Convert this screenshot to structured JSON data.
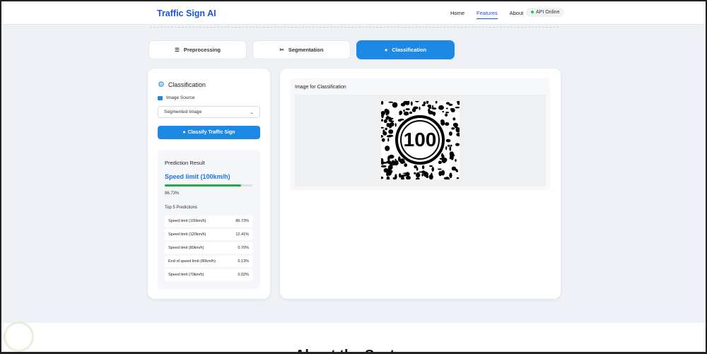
{
  "nav": {
    "brand": "Traffic Sign AI",
    "links": [
      "Home",
      "Features",
      "About"
    ],
    "active": "Features",
    "status": "API Online"
  },
  "tabs": [
    {
      "label": "Preprocessing",
      "icon": "sliders-icon"
    },
    {
      "label": "Segmentation",
      "icon": "scissors-icon"
    },
    {
      "label": "Classification",
      "icon": "brain-icon",
      "active": true
    }
  ],
  "panel": {
    "title": "Classification",
    "source_label": "Image Source",
    "source_value": "Segmented Image",
    "button": "Classify Traffic Sign"
  },
  "prediction": {
    "title": "Prediction Result",
    "name": "Speed limit (100km/h)",
    "confidence": "86.73%",
    "confidence_value": 0.8673,
    "top5_title": "Top 5 Predictions",
    "top5": [
      {
        "label": "Speed limit (100km/h)",
        "value": "86.73%"
      },
      {
        "label": "Speed limit (120km/h)",
        "value": "12.41%"
      },
      {
        "label": "Speed limit (80km/h)",
        "value": "0.70%"
      },
      {
        "label": "End of speed limit (80km/h)",
        "value": "0.13%"
      },
      {
        "label": "Speed limit (70km/h)",
        "value": "0.02%"
      }
    ]
  },
  "image": {
    "title": "Image for Classification",
    "sign_text": "100"
  },
  "about": {
    "title": "About the System"
  },
  "colors": {
    "accent": "#1e88e5",
    "brand": "#1a56db",
    "bar": "#28a745"
  }
}
